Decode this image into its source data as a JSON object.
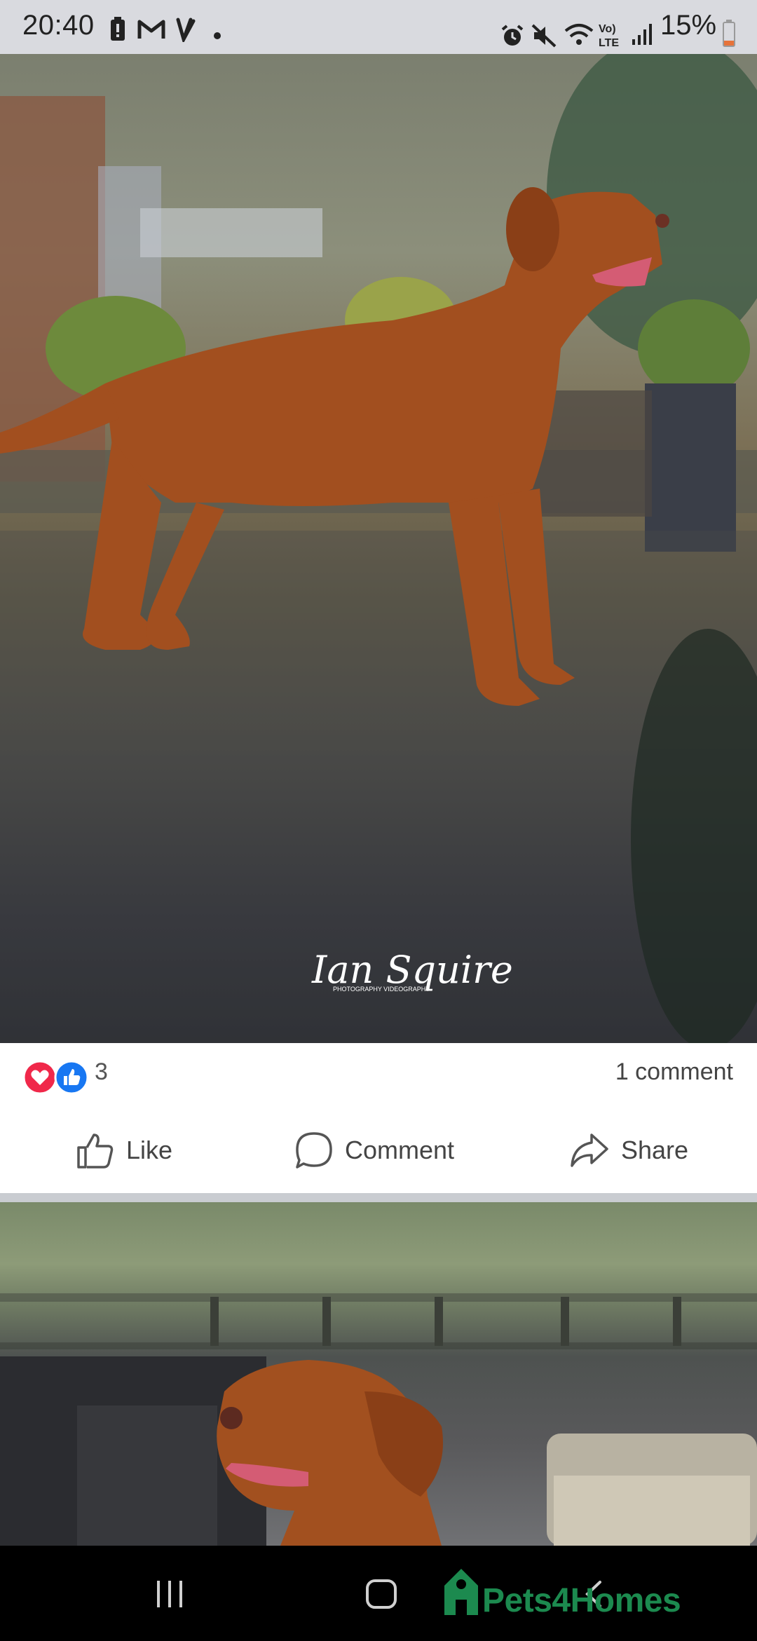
{
  "status_bar": {
    "time": "20:40",
    "battery": "15%",
    "left_icons": [
      "battery-saver-icon",
      "gmail-icon",
      "vinted-icon",
      "dot-icon"
    ],
    "right_icons": [
      "alarm-icon",
      "mute-icon",
      "wifi-icon",
      "volte-icon",
      "signal-icon",
      "battery-icon"
    ]
  },
  "post_1": {
    "photo_watermark": "Ian Squire",
    "photo_watermark_sub": "PHOTOGRAPHY   VIDEOGRAPHY",
    "reactions": {
      "icons": [
        "love-reaction-icon",
        "like-reaction-icon"
      ],
      "count": "3"
    },
    "comment_count": "1 comment",
    "actions": {
      "like": "Like",
      "comment": "Comment",
      "share": "Share"
    }
  },
  "nav_bar": {
    "icons": [
      "recent-apps-icon",
      "home-icon",
      "back-icon"
    ]
  },
  "watermark": {
    "brand": "Pets4Homes"
  },
  "colors": {
    "status_bar_bg": "#d9dadf",
    "love_red": "#f0284a",
    "like_blue": "#1877f2",
    "brand_green": "#1c8a4f",
    "divider": "#c9ccd1"
  }
}
